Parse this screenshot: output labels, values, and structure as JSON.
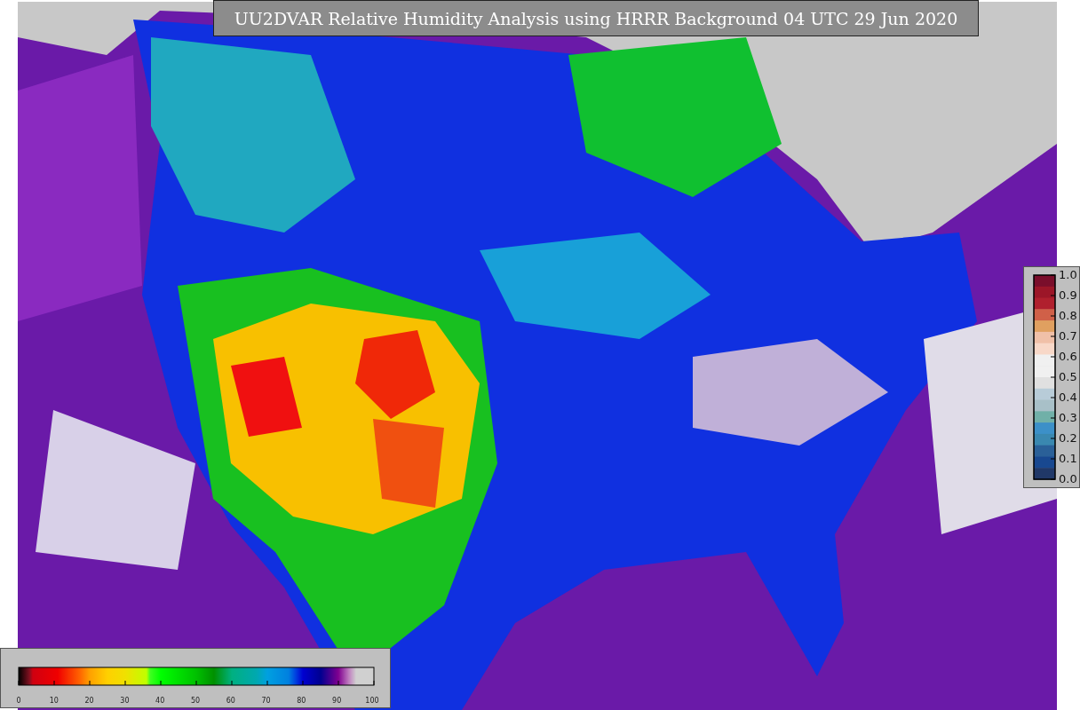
{
  "title": "UU2DVAR Relative Humidity Analysis using HRRR Background 04 UTC 29 Jun 2020",
  "humidity_colorbar": {
    "ticks": [
      "0",
      "10",
      "20",
      "30",
      "40",
      "50",
      "60",
      "70",
      "80",
      "90",
      "100"
    ]
  },
  "difference_colorbar": {
    "ticks": [
      "1.0",
      "0.9",
      "0.8",
      "0.7",
      "0.6",
      "0.5",
      "0.4",
      "0.3",
      "0.2",
      "0.1",
      "0.0"
    ]
  }
}
